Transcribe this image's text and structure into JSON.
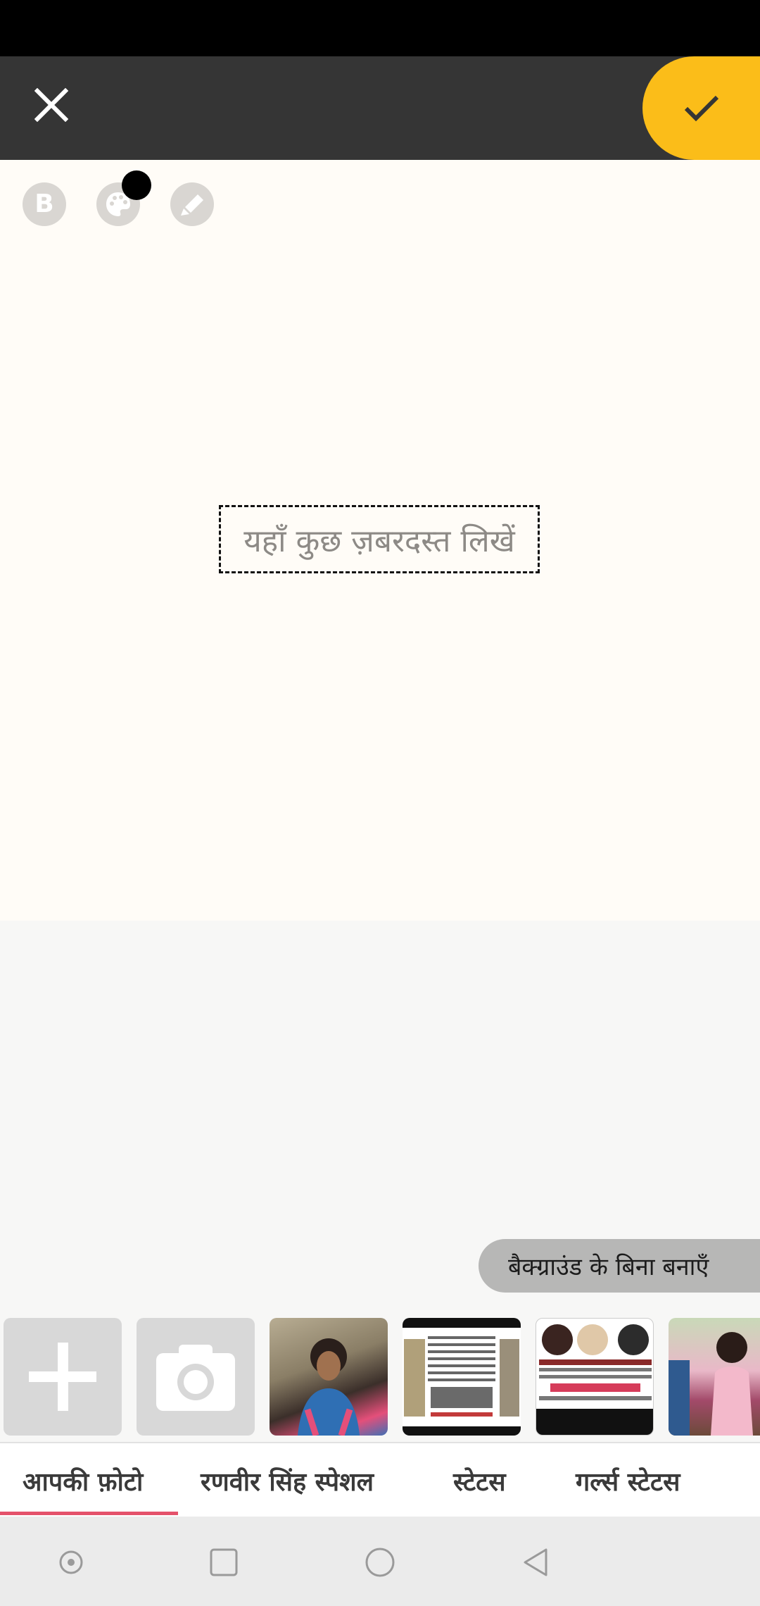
{
  "colors": {
    "accent": "#fbbd19",
    "toolbar": "#353535",
    "canvas": "#fffcf7",
    "tab_indicator": "#e4526b"
  },
  "toolbar": {
    "close_icon": "close-icon",
    "done_icon": "check-icon"
  },
  "tools": [
    {
      "name": "bold",
      "icon": "bold-icon",
      "glyph": "B"
    },
    {
      "name": "text-color",
      "icon": "palette-icon",
      "selected_color": "#000000"
    },
    {
      "name": "background-color",
      "icon": "brush-icon"
    }
  ],
  "canvas": {
    "placeholder": "यहाँ कुछ ज़बरदस्त लिखें"
  },
  "no_background_button": {
    "label": "बैक्ग्राउंड के बिना बनाएँ"
  },
  "gallery": {
    "add_icon": "plus-icon",
    "camera_icon": "camera-icon"
  },
  "tabs": [
    {
      "label": "आपकी फ़ोटो",
      "selected": true
    },
    {
      "label": "रणवीर सिंह स्पेशल",
      "selected": false
    },
    {
      "label": "स्टेटस",
      "selected": false
    },
    {
      "label": "गर्ल्स स्टेटस",
      "selected": false
    }
  ],
  "navbar": {
    "buttons": [
      "record-icon",
      "recents-icon",
      "home-icon",
      "back-icon"
    ]
  }
}
